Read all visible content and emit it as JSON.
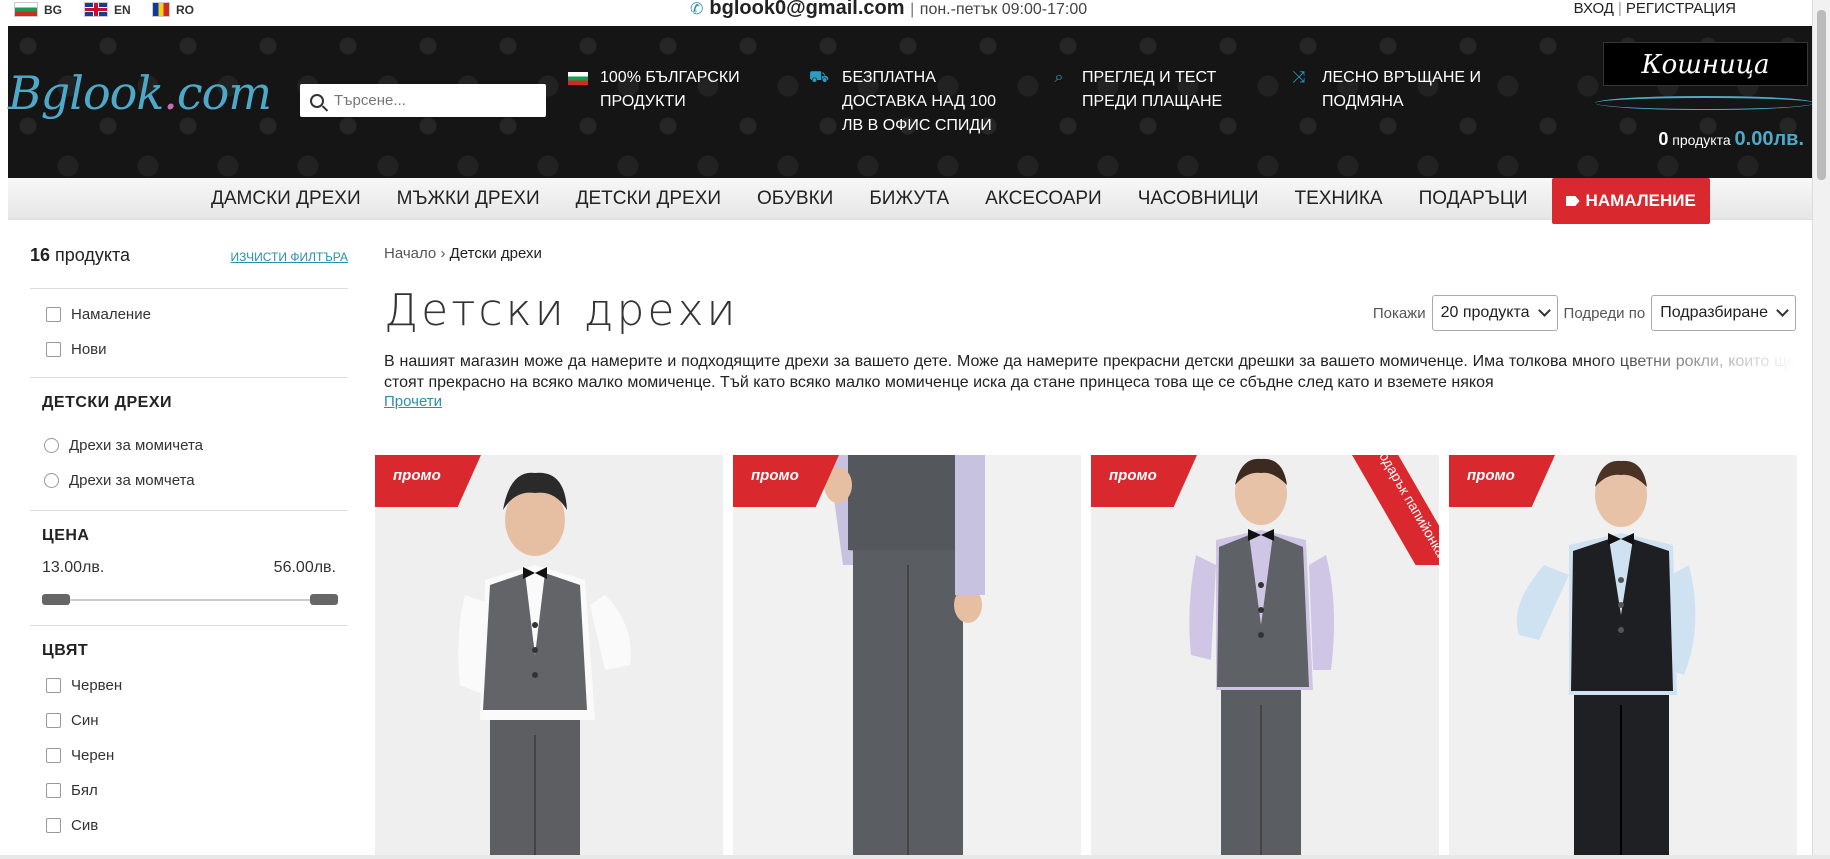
{
  "languages": [
    {
      "code": "BG",
      "flag": "flag-bg-icon"
    },
    {
      "code": "EN",
      "flag": "flag-en-icon"
    },
    {
      "code": "RO",
      "flag": "flag-ro-icon"
    }
  ],
  "contact": {
    "email": "bglook0@gmail.com",
    "separator": "|",
    "hours": "пон.-петък 09:00-17:00"
  },
  "auth": {
    "login": "ВХОД",
    "separator": "|",
    "register": "РЕГИСТРАЦИЯ"
  },
  "logo": {
    "text": "Bglook",
    "dot": ".",
    "suffix": "com"
  },
  "search": {
    "placeholder": "Търсене..."
  },
  "features": [
    {
      "icon": "bulgarian-flag-icon",
      "line1": "100% БЪЛГАРСКИ",
      "line2": "ПРОДУКТИ",
      "line3": ""
    },
    {
      "icon": "truck-icon",
      "line1": "БЕЗПЛАТНА",
      "line2": "ДОСТАВКА НАД 100",
      "line3": "ЛВ В ОФИС СПИДИ"
    },
    {
      "icon": "search-icon",
      "line1": "ПРЕГЛЕД И ТЕСТ",
      "line2": "ПРЕДИ ПЛАЩАНЕ",
      "line3": ""
    },
    {
      "icon": "shuffle-icon",
      "line1": "ЛЕСНО ВРЪЩАНЕ И",
      "line2": "ПОДМЯНА",
      "line3": ""
    }
  ],
  "basket": {
    "title": "Кошница",
    "count": "0",
    "count_label": "продукта",
    "total": "0.00лв."
  },
  "nav": {
    "items": [
      "ДАМСКИ ДРЕХИ",
      "МЪЖКИ ДРЕХИ",
      "ДЕТСКИ ДРЕХИ",
      "ОБУВКИ",
      "БИЖУТА",
      "АКСЕСОАРИ",
      "ЧАСОВНИЦИ",
      "ТЕХНИКА",
      "ПОДАРЪЦИ"
    ],
    "sale": "НАМАЛЕНИЕ"
  },
  "sidebar": {
    "count": "16",
    "count_label": "продукта",
    "clear": "ИЗЧИСТИ ФИЛТЪРА",
    "flags": [
      "Намаление",
      "Нови"
    ],
    "category_title": "ДЕТСКИ ДРЕХИ",
    "categories": [
      "Дрехи за момичета",
      "Дрехи за момчета"
    ],
    "price_title": "ЦЕНА",
    "price_min": "13.00лв.",
    "price_max": "56.00лв.",
    "color_title": "ЦВЯТ",
    "colors": [
      "Червен",
      "Син",
      "Черен",
      "Бял",
      "Сив"
    ]
  },
  "breadcrumb": {
    "home": "Начало",
    "sep": "›",
    "current": "Детски дрехи"
  },
  "page": {
    "title": "Детски дрехи",
    "show_label": "Покажи",
    "show_value": "20 продукта",
    "sort_label": "Подреди по",
    "sort_value": "Подразбиране",
    "description": "В нашият магазин може да намерите и подходящите дрехи за вашето дете. Може да намерите прекрасни детски дрешки за вашето момиченце. Има толкова много цветни рокли, които ще стоят прекрасно на всяко малко момиченце. Тъй като всяко малко момиченце иска да стане принцеса това ще се сбъдне след като и вземете някоя",
    "read_more": "Прочети"
  },
  "products": [
    {
      "badge": "промо",
      "gift": ""
    },
    {
      "badge": "промо",
      "gift": ""
    },
    {
      "badge": "промо",
      "gift": "подарък папийонка"
    },
    {
      "badge": "промо",
      "gift": ""
    }
  ],
  "colors": {
    "accent": "#2a8fa8",
    "sale": "#d9282e",
    "header_bg": "#151515"
  }
}
